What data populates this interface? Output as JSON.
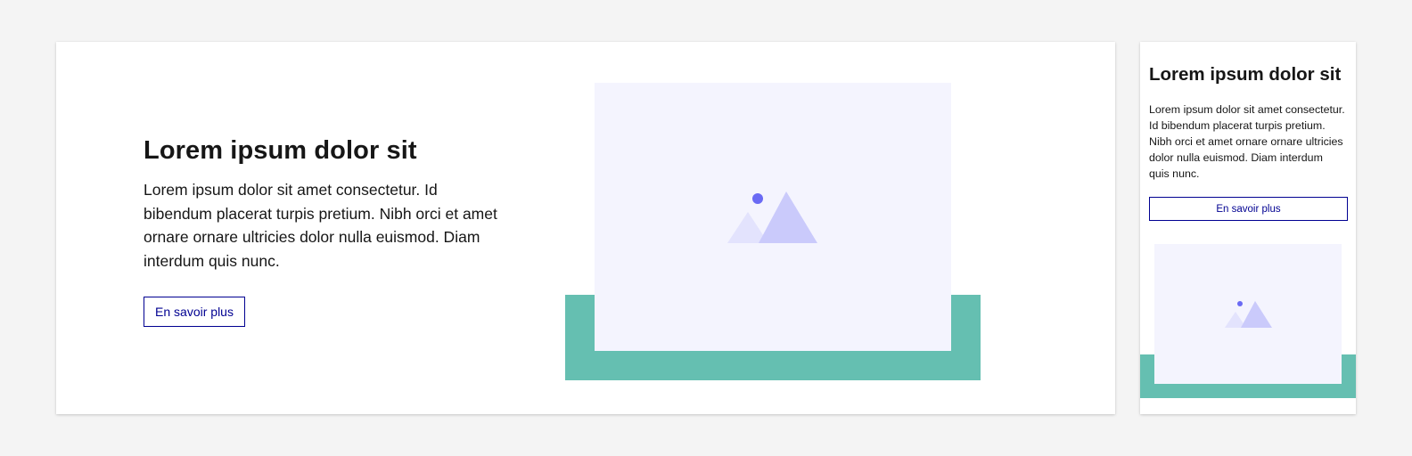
{
  "desktop_card": {
    "title": "Lorem ipsum dolor sit",
    "description": "Lorem ipsum dolor sit amet consectetur. Id bibendum placerat turpis pretium. Nibh orci et amet ornare ornare ultricies dolor nulla euismod. Diam interdum quis nunc.",
    "button_label": "En savoir plus",
    "image_icon": "image-placeholder-icon"
  },
  "mobile_card": {
    "title": "Lorem ipsum dolor sit",
    "description": "Lorem ipsum dolor sit amet consectetur. Id bibendum placerat turpis pretium. Nibh orci et amet ornare ornare ultricies dolor nulla euismod. Diam interdum quis nunc.",
    "button_label": "En savoir plus",
    "image_icon": "image-placeholder-icon"
  },
  "colors": {
    "background": "#f4f4f4",
    "card": "#ffffff",
    "accent_green": "#65bfb1",
    "image_placeholder": "#f4f4fe",
    "button_blue": "#000091",
    "icon_sun": "#6a6af4",
    "icon_mountain_front": "#cacafb",
    "icon_mountain_back": "#e3e3fd"
  }
}
